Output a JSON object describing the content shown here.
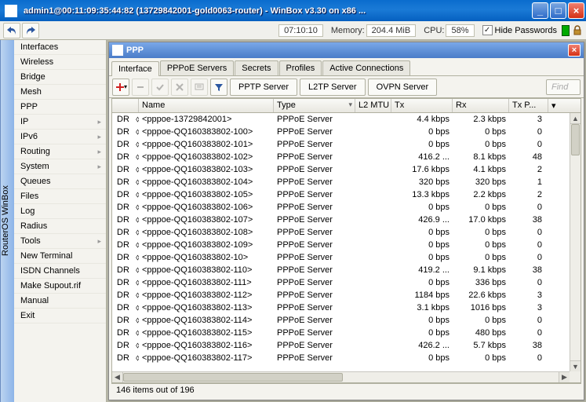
{
  "window": {
    "title": "admin1@00:11:09:35:44:82 (13729842001-gold0063-router) - WinBox v3.30 on x86 ..."
  },
  "toolbar": {
    "time": "07:10:10",
    "mem_label": "Memory:",
    "mem_value": "204.4 MiB",
    "cpu_label": "CPU:",
    "cpu_value": "58%",
    "hide_pw": "Hide Passwords"
  },
  "vtab": "RouterOS WinBox",
  "sidebar": {
    "items": [
      {
        "label": "Interfaces",
        "sub": false
      },
      {
        "label": "Wireless",
        "sub": false
      },
      {
        "label": "Bridge",
        "sub": false
      },
      {
        "label": "Mesh",
        "sub": false
      },
      {
        "label": "PPP",
        "sub": false
      },
      {
        "label": "IP",
        "sub": true
      },
      {
        "label": "IPv6",
        "sub": true
      },
      {
        "label": "Routing",
        "sub": true
      },
      {
        "label": "System",
        "sub": true
      },
      {
        "label": "Queues",
        "sub": false
      },
      {
        "label": "Files",
        "sub": false
      },
      {
        "label": "Log",
        "sub": false
      },
      {
        "label": "Radius",
        "sub": false
      },
      {
        "label": "Tools",
        "sub": true
      },
      {
        "label": "New Terminal",
        "sub": false
      },
      {
        "label": "ISDN Channels",
        "sub": false
      },
      {
        "label": "Make Supout.rif",
        "sub": false
      },
      {
        "label": "Manual",
        "sub": false
      },
      {
        "label": "Exit",
        "sub": false
      }
    ]
  },
  "ppp": {
    "title": "PPP",
    "tabs": [
      "Interface",
      "PPPoE Servers",
      "Secrets",
      "Profiles",
      "Active Connections"
    ],
    "active_tab": 0,
    "buttons": {
      "pptp": "PPTP Server",
      "l2tp": "L2TP Server",
      "ovpn": "OVPN Server",
      "find": "Find"
    },
    "columns": [
      "Name",
      "Type",
      "L2 MTU",
      "Tx",
      "Rx",
      "Tx P..."
    ],
    "rows": [
      {
        "flag": "DR",
        "link": "⬨⬨",
        "name": "<pppoe-13729842001>",
        "type": "PPPoE Server",
        "mtu": "",
        "tx": "4.4 kbps",
        "rx": "2.3 kbps",
        "txp": "3"
      },
      {
        "flag": "DR",
        "link": "⬨⬨",
        "name": "<pppoe-QQ160383802-100>",
        "type": "PPPoE Server",
        "mtu": "",
        "tx": "0 bps",
        "rx": "0 bps",
        "txp": "0"
      },
      {
        "flag": "DR",
        "link": "⬨⬨",
        "name": "<pppoe-QQ160383802-101>",
        "type": "PPPoE Server",
        "mtu": "",
        "tx": "0 bps",
        "rx": "0 bps",
        "txp": "0"
      },
      {
        "flag": "DR",
        "link": "⬨⬨",
        "name": "<pppoe-QQ160383802-102>",
        "type": "PPPoE Server",
        "mtu": "",
        "tx": "416.2 ...",
        "rx": "8.1 kbps",
        "txp": "48"
      },
      {
        "flag": "DR",
        "link": "⬨⬨",
        "name": "<pppoe-QQ160383802-103>",
        "type": "PPPoE Server",
        "mtu": "",
        "tx": "17.6 kbps",
        "rx": "4.1 kbps",
        "txp": "2"
      },
      {
        "flag": "DR",
        "link": "⬨⬨",
        "name": "<pppoe-QQ160383802-104>",
        "type": "PPPoE Server",
        "mtu": "",
        "tx": "320 bps",
        "rx": "320 bps",
        "txp": "1"
      },
      {
        "flag": "DR",
        "link": "⬨⬨",
        "name": "<pppoe-QQ160383802-105>",
        "type": "PPPoE Server",
        "mtu": "",
        "tx": "13.3 kbps",
        "rx": "2.2 kbps",
        "txp": "2"
      },
      {
        "flag": "DR",
        "link": "⬨⬨",
        "name": "<pppoe-QQ160383802-106>",
        "type": "PPPoE Server",
        "mtu": "",
        "tx": "0 bps",
        "rx": "0 bps",
        "txp": "0"
      },
      {
        "flag": "DR",
        "link": "⬨⬨",
        "name": "<pppoe-QQ160383802-107>",
        "type": "PPPoE Server",
        "mtu": "",
        "tx": "426.9 ...",
        "rx": "17.0 kbps",
        "txp": "38"
      },
      {
        "flag": "DR",
        "link": "⬨⬨",
        "name": "<pppoe-QQ160383802-108>",
        "type": "PPPoE Server",
        "mtu": "",
        "tx": "0 bps",
        "rx": "0 bps",
        "txp": "0"
      },
      {
        "flag": "DR",
        "link": "⬨⬨",
        "name": "<pppoe-QQ160383802-109>",
        "type": "PPPoE Server",
        "mtu": "",
        "tx": "0 bps",
        "rx": "0 bps",
        "txp": "0"
      },
      {
        "flag": "DR",
        "link": "⬨⬨",
        "name": "<pppoe-QQ160383802-10>",
        "type": "PPPoE Server",
        "mtu": "",
        "tx": "0 bps",
        "rx": "0 bps",
        "txp": "0"
      },
      {
        "flag": "DR",
        "link": "⬨⬨",
        "name": "<pppoe-QQ160383802-110>",
        "type": "PPPoE Server",
        "mtu": "",
        "tx": "419.2 ...",
        "rx": "9.1 kbps",
        "txp": "38"
      },
      {
        "flag": "DR",
        "link": "⬨⬨",
        "name": "<pppoe-QQ160383802-111>",
        "type": "PPPoE Server",
        "mtu": "",
        "tx": "0 bps",
        "rx": "336 bps",
        "txp": "0"
      },
      {
        "flag": "DR",
        "link": "⬨⬨",
        "name": "<pppoe-QQ160383802-112>",
        "type": "PPPoE Server",
        "mtu": "",
        "tx": "1184 bps",
        "rx": "22.6 kbps",
        "txp": "3"
      },
      {
        "flag": "DR",
        "link": "⬨⬨",
        "name": "<pppoe-QQ160383802-113>",
        "type": "PPPoE Server",
        "mtu": "",
        "tx": "3.1 kbps",
        "rx": "1016 bps",
        "txp": "3"
      },
      {
        "flag": "DR",
        "link": "⬨⬨",
        "name": "<pppoe-QQ160383802-114>",
        "type": "PPPoE Server",
        "mtu": "",
        "tx": "0 bps",
        "rx": "0 bps",
        "txp": "0"
      },
      {
        "flag": "DR",
        "link": "⬨⬨",
        "name": "<pppoe-QQ160383802-115>",
        "type": "PPPoE Server",
        "mtu": "",
        "tx": "0 bps",
        "rx": "480 bps",
        "txp": "0"
      },
      {
        "flag": "DR",
        "link": "⬨⬨",
        "name": "<pppoe-QQ160383802-116>",
        "type": "PPPoE Server",
        "mtu": "",
        "tx": "426.2 ...",
        "rx": "5.7 kbps",
        "txp": "38"
      },
      {
        "flag": "DR",
        "link": "⬨⬨",
        "name": "<pppoe-QQ160383802-117>",
        "type": "PPPoE Server",
        "mtu": "",
        "tx": "0 bps",
        "rx": "0 bps",
        "txp": "0"
      }
    ],
    "status": "146 items out of 196"
  }
}
